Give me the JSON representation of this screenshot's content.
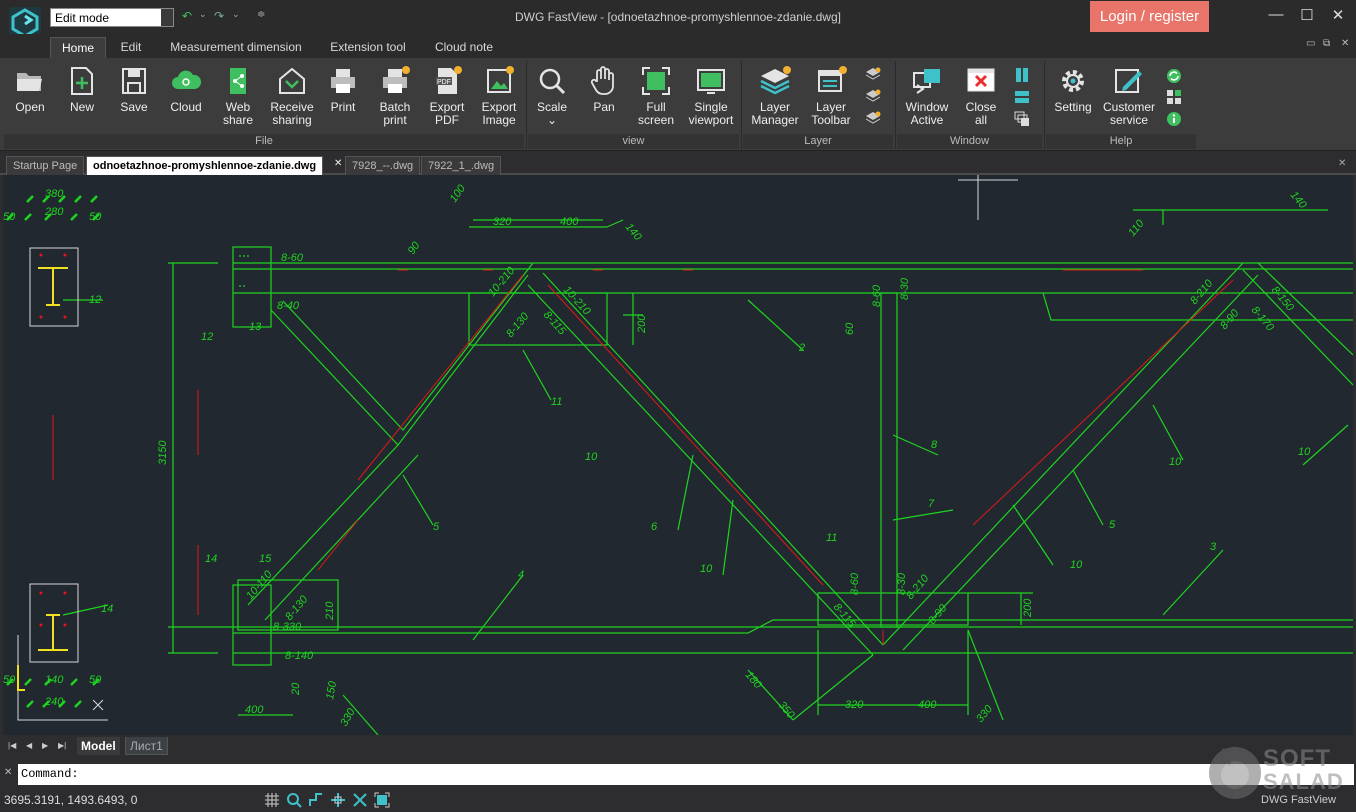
{
  "app": {
    "window_title": "DWG FastView - [odnoetazhnoe-promyshlennoe-zdanie.dwg]",
    "mode_value": "Edit mode",
    "login_label": "Login / register",
    "brand": "DWG FastView"
  },
  "ribbon": {
    "tabs": [
      {
        "label": "Home"
      },
      {
        "label": "Edit"
      },
      {
        "label": "Measurement dimension"
      },
      {
        "label": "Extension tool"
      },
      {
        "label": "Cloud note"
      }
    ],
    "groups": {
      "file": {
        "label": "File",
        "buttons": [
          {
            "l1": "Open",
            "l2": ""
          },
          {
            "l1": "New",
            "l2": ""
          },
          {
            "l1": "Save",
            "l2": ""
          },
          {
            "l1": "Cloud",
            "l2": ""
          },
          {
            "l1": "Web",
            "l2": "share"
          },
          {
            "l1": "Receive",
            "l2": "sharing"
          },
          {
            "l1": "Print",
            "l2": ""
          },
          {
            "l1": "Batch",
            "l2": "print"
          },
          {
            "l1": "Export",
            "l2": "PDF"
          },
          {
            "l1": "Export",
            "l2": "Image"
          }
        ]
      },
      "view": {
        "label": "view",
        "buttons": [
          {
            "l1": "Scale",
            "l2": "⌄"
          },
          {
            "l1": "Pan",
            "l2": ""
          },
          {
            "l1": "Full",
            "l2": "screen"
          },
          {
            "l1": "Single",
            "l2": "viewport"
          }
        ]
      },
      "layer": {
        "label": "Layer",
        "buttons": [
          {
            "l1": "Layer",
            "l2": "Manager"
          },
          {
            "l1": "Layer",
            "l2": "Toolbar"
          }
        ]
      },
      "window": {
        "label": "Window",
        "buttons": [
          {
            "l1": "Window",
            "l2": "Active"
          },
          {
            "l1": "Close",
            "l2": "all"
          }
        ]
      },
      "help": {
        "label": "Help",
        "buttons": [
          {
            "l1": "Setting",
            "l2": ""
          },
          {
            "l1": "Customer",
            "l2": "service"
          }
        ]
      }
    }
  },
  "doc_tabs": [
    {
      "label": "Startup Page"
    },
    {
      "label": "odnoetazhnoe-promyshlennoe-zdanie.dwg"
    },
    {
      "label": "7928_--.dwg"
    },
    {
      "label": "7922_1_.dwg"
    }
  ],
  "drawing": {
    "texts": [
      "380",
      "280",
      "50",
      "50",
      "12",
      "14",
      "50",
      "140",
      "50",
      "240",
      "100",
      "320",
      "400",
      "140",
      "90",
      "8-60",
      "8-40",
      "13",
      "12",
      "10-210",
      "10-210",
      "8-130",
      "8-115",
      "200",
      "2",
      "11",
      "10",
      "6",
      "5",
      "10",
      "3150",
      "8-60",
      "8-30",
      "60",
      "8",
      "7",
      "11",
      "14",
      "15",
      "10-110",
      "8-130",
      "8-330",
      "210",
      "8-140",
      "20",
      "150",
      "400",
      "330",
      "4",
      "8-60",
      "8-30",
      "8-210",
      "8-115",
      "8-90",
      "200",
      "180",
      "350",
      "320",
      "400",
      "330",
      "110",
      "140",
      "8-210",
      "8-90",
      "8-170",
      "8-150",
      "10",
      "10",
      "5",
      "10",
      "3"
    ]
  },
  "layout_tabs": [
    {
      "label": "Model"
    },
    {
      "label": "Лист1"
    }
  ],
  "command": {
    "prompt": "Command:"
  },
  "status": {
    "coords": "3695.3191, 1493.6493, 0"
  },
  "watermark": {
    "line1": "SOFT",
    "line2": "SALAD"
  },
  "colors": {
    "accent_login": "#e8746a",
    "cad_green": "#00ff00",
    "cad_red": "#ff0000",
    "cad_yellow": "#ffff00",
    "canvas_bg": "#212830"
  }
}
